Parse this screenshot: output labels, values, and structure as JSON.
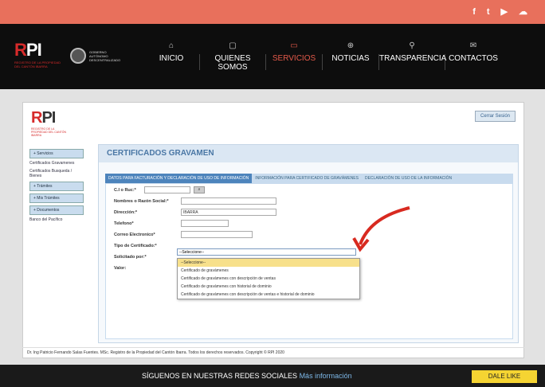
{
  "social": {
    "icons": [
      "facebook-icon",
      "twitter-icon",
      "youtube-icon",
      "soundcloud-icon"
    ],
    "glyphs": [
      "f",
      "t",
      "▶",
      "☁"
    ]
  },
  "logo": {
    "r": "R",
    "pi": "PI",
    "sub": "REGISTRO DE LA PROPIEDAD DEL CANTÓN IBARRA"
  },
  "gov": {
    "text": "GOBIERNO AUTÓNOMO DESCENTRALIZADO"
  },
  "nav": [
    {
      "label": "INICIO",
      "icon": "⌂"
    },
    {
      "label": "QUIENES SOMOS",
      "icon": "▢"
    },
    {
      "label": "SERVICIOS",
      "icon": "▭"
    },
    {
      "label": "NOTICIAS",
      "icon": "⊕"
    },
    {
      "label": "TRANSPARENCIA",
      "icon": "⚲"
    },
    {
      "label": "CONTACTOS",
      "icon": "✉"
    }
  ],
  "panel": {
    "logout": "Cerrar Sesión"
  },
  "sidebar": {
    "servicios": "+ Servicios",
    "cert_grav": "Certificados Gravamenes",
    "cert_bienes": "Certificados Busqueda / Bienes",
    "tramites": "+ Trámites",
    "mis_tramites": "+ Mis Trámites",
    "documentos": "+ Documentos",
    "banco": "Banco del Pacífico"
  },
  "main": {
    "title": "CERTIFICADOS GRAVAMEN",
    "tabs": [
      "DATOS PARA FACTURACIÓN Y DECLARACIÓN DE USO DE INFORMACIÓN",
      "INFORMACIÓN PARA CERTIFICADO DE GRAVÁMENES",
      "DECLARACIÓN DE USO DE LA INFORMACIÓN"
    ],
    "labels": {
      "ci": "C.I o Ruc:*",
      "nombres": "Nombres o Razón Social:*",
      "direccion": "Dirección:*",
      "telefono": "Telefono*",
      "correo": "Correo Electronico*",
      "tipo": "Tipo de Certificado:*",
      "solicitado": "Solicitado por:*",
      "valor": "Valor:"
    },
    "values": {
      "direccion": "IBARRA",
      "tipo": "--Seleccione--"
    },
    "options": [
      "--Seleccione--",
      "Certificado de gravámenes",
      "Certificado de gravámenes con descripción de ventas",
      "Certificado de gravámenes con historial de dominio",
      "Certificado de gravámenes con descripción de ventas e historial de dominio"
    ]
  },
  "footer": "Dr. Ing Patricio Fernando Salas Fuentes. MSc. Registro de la Propiedad del Cantón Ibarra. Todos los derechos reservados. Copyright © RPI 2020",
  "bottom": {
    "follow": "SÍGUENOS EN NUESTRAS REDES SOCIALES",
    "more": "Más información",
    "like": "DALE LIKE"
  }
}
